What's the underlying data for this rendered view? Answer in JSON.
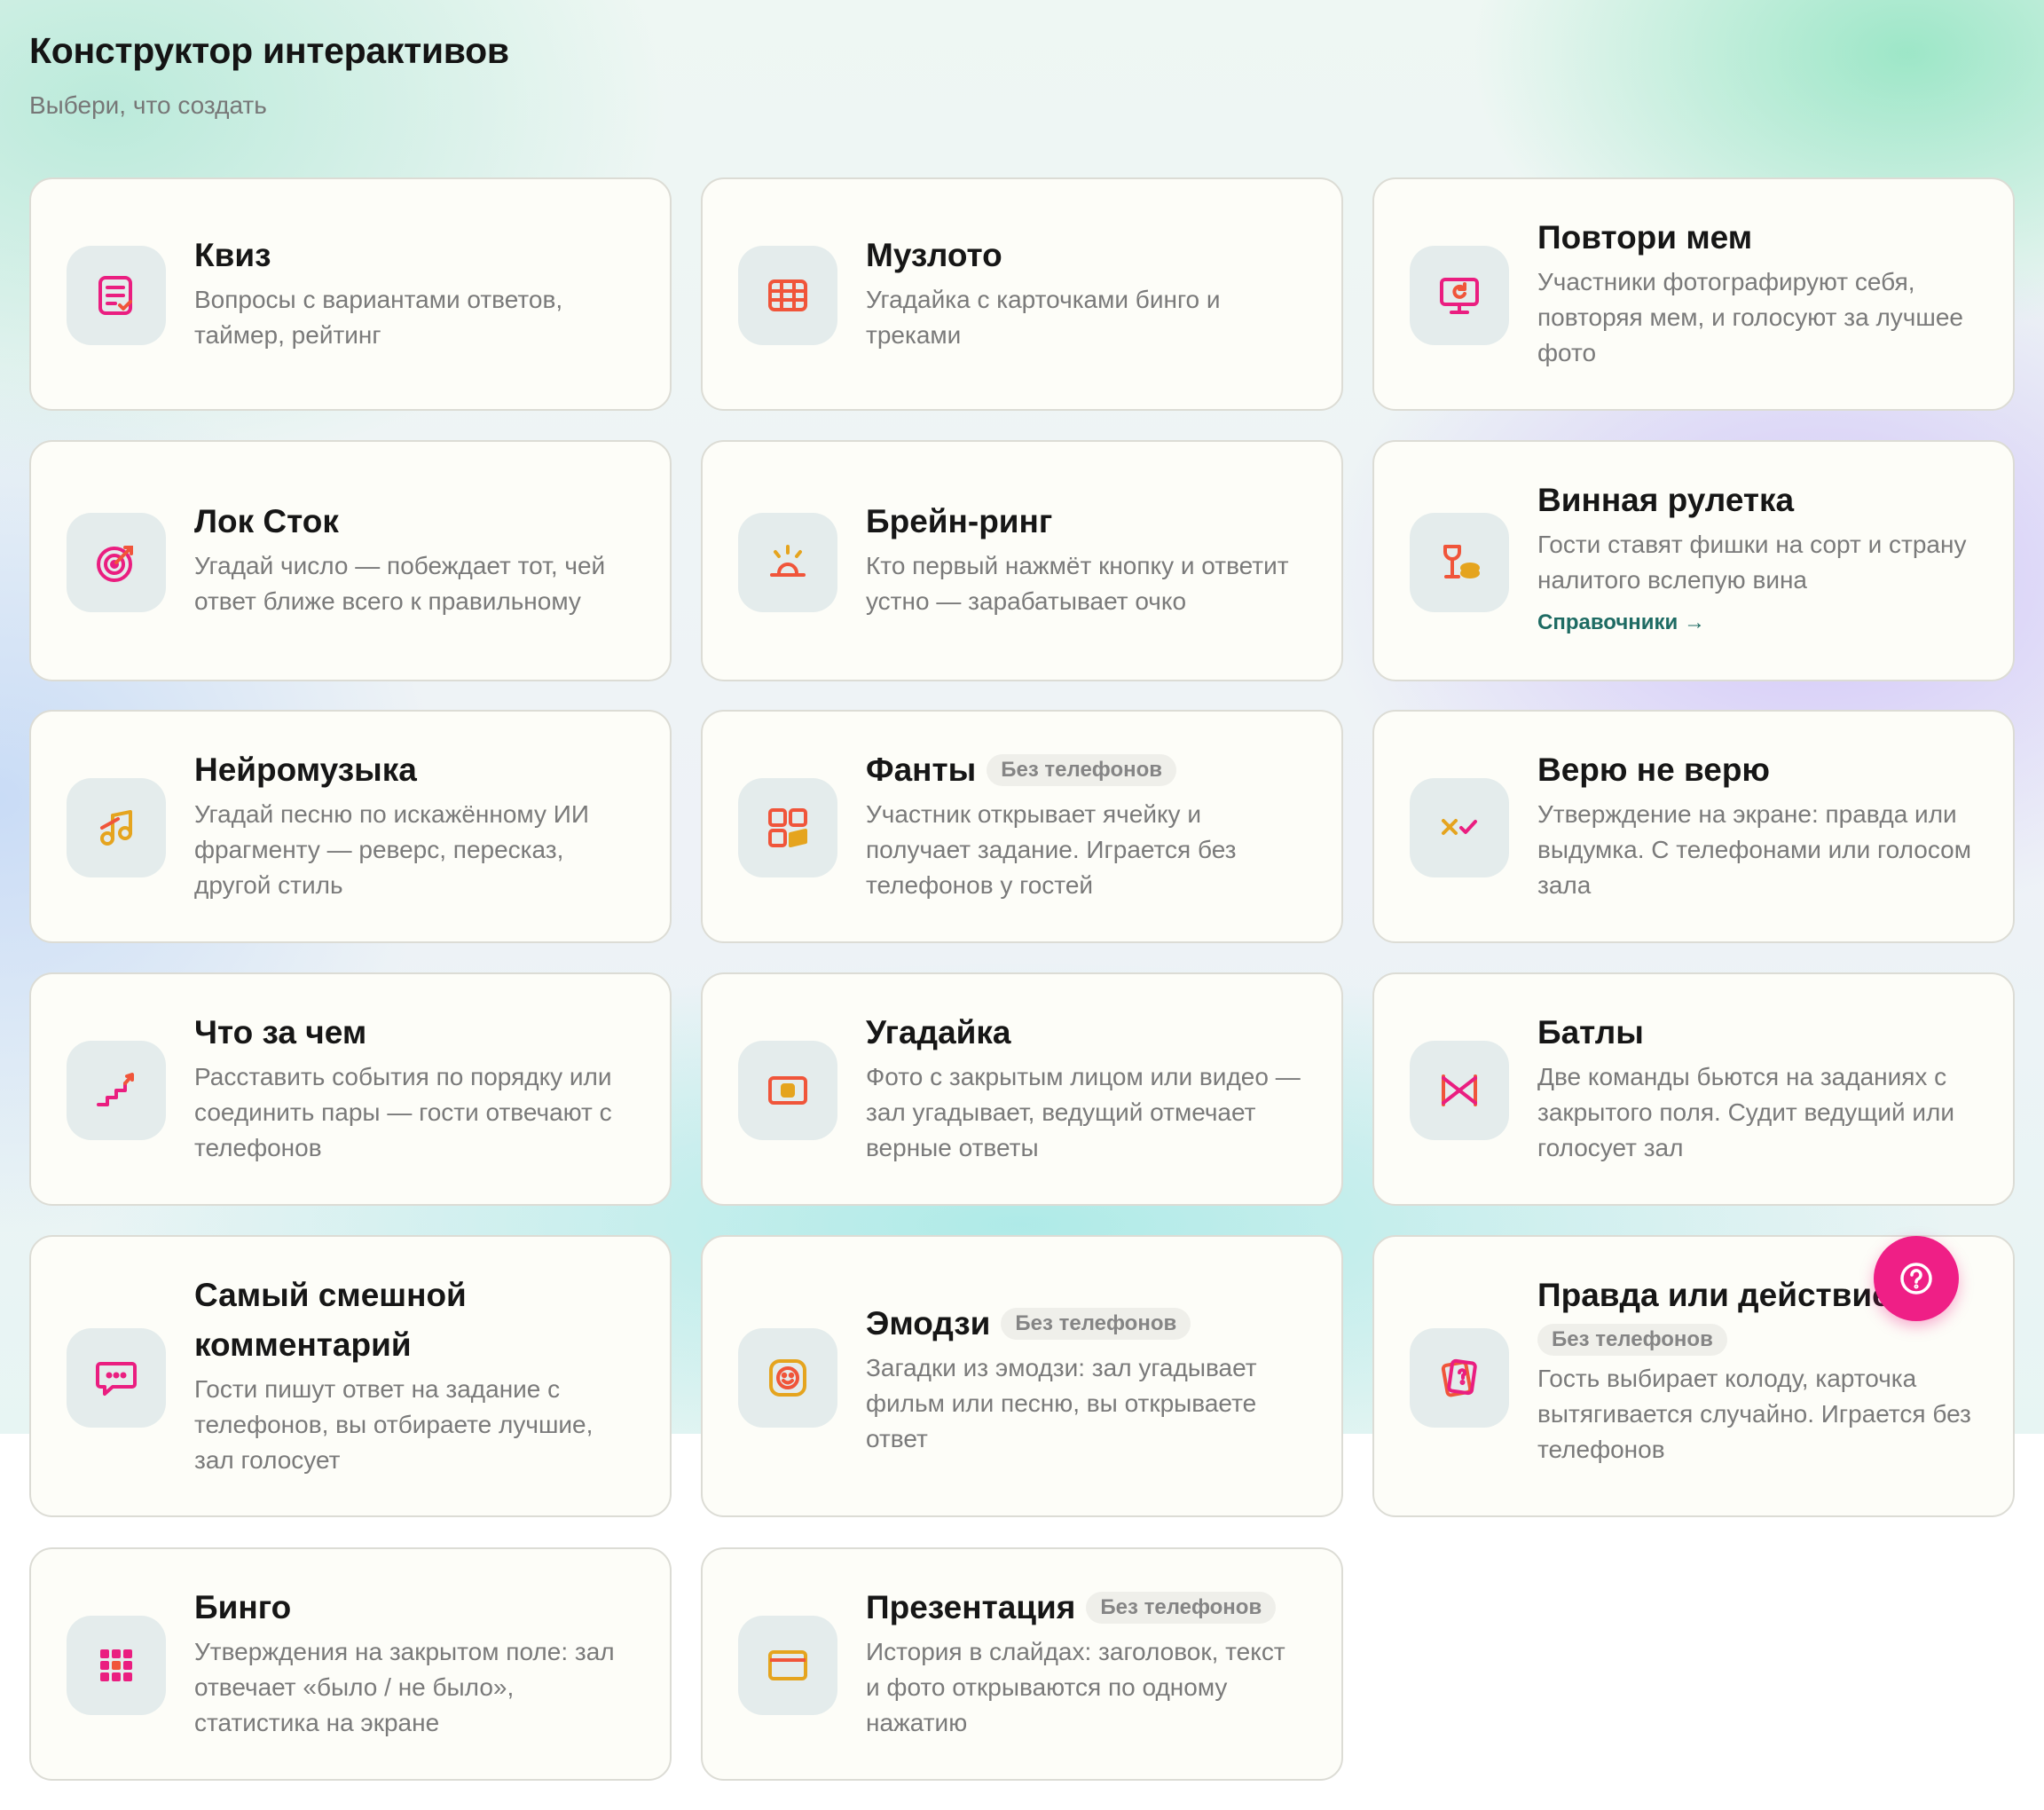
{
  "header": {
    "title": "Конструктор интерактивов",
    "subtitle": "Выбери, что создать"
  },
  "cards": [
    {
      "title": "Квиз",
      "desc": "Вопросы с вариантами ответов, таймер, рейтинг",
      "icon": "quiz-icon"
    },
    {
      "title": "Музлото",
      "desc": "Угадайка с карточками бинго и треками",
      "icon": "grid-icon"
    },
    {
      "title": "Повтори мем",
      "desc": "Участники фотографируют себя, повторяя мем, и голосуют за лучшее фото",
      "icon": "monitor-icon"
    },
    {
      "title": "Лок Сток",
      "desc": "Угадай число — побеждает тот, чей ответ ближе всего к правильному",
      "icon": "target-icon"
    },
    {
      "title": "Брейн-ринг",
      "desc": "Кто первый нажмёт кнопку и ответит устно — зарабатывает очко",
      "icon": "buzzer-icon"
    },
    {
      "title": "Винная рулетка",
      "desc": "Гости ставят фишки на сорт и страну налитого вслепую вина",
      "link": "Справочники →",
      "icon": "wine-icon"
    },
    {
      "title": "Нейромузыка",
      "desc": "Угадай песню по искажённому ИИ фрагменту — реверс, пересказ, другой стиль",
      "icon": "music-note-icon"
    },
    {
      "title": "Фанты",
      "badge": "Без телефонов",
      "desc": "Участник открывает ячейку и получает задание. Играется без телефонов у гостей",
      "icon": "tiles-icon"
    },
    {
      "title": "Верю не верю",
      "desc": "Утверждение на экране: правда или выдумка. С телефонами или голосом зала",
      "icon": "cross-check-icon"
    },
    {
      "title": "Что за чем",
      "desc": "Расставить события по порядку или соединить пары — гости отвечают с телефонов",
      "icon": "stairs-icon"
    },
    {
      "title": "Угадайка",
      "desc": "Фото с закрытым лицом или видео — зал угадывает, ведущий отмечает верные ответы",
      "icon": "hidden-photo-icon"
    },
    {
      "title": "Батлы",
      "desc": "Две команды бьются на заданиях с закрытого поля. Судит ведущий или голосует зал",
      "icon": "versus-icon"
    },
    {
      "title": "Самый смешной комментарий",
      "desc": "Гости пишут ответ на задание с телефонов, вы отбираете лучшие, зал голосует",
      "icon": "chat-bubble-icon"
    },
    {
      "title": "Эмодзи",
      "badge": "Без телефонов",
      "desc": "Загадки из эмодзи: зал угадывает фильм или песню, вы открываете ответ",
      "icon": "emoji-icon"
    },
    {
      "title": "Правда или действие",
      "badge": "Без телефонов",
      "desc": "Гость выбирает колоду, карточка вытягивается случайно. Играется без телефонов",
      "icon": "cards-icon"
    },
    {
      "title": "Бинго",
      "desc": "Утверждения на закрытом поле: зал отвечает «было / не было», статистика на экране",
      "icon": "bingo-grid-icon"
    },
    {
      "title": "Презентация",
      "badge": "Без телефонов",
      "desc": "История в слайдах: заголовок, текст и фото открываются по одному нажатию",
      "icon": "slides-icon"
    }
  ],
  "help_button": {
    "icon": "question-icon"
  },
  "colors": {
    "pink": "#ea1e80",
    "orange": "#f0553a",
    "gold": "#e5a41e",
    "link": "#1e6b63"
  }
}
